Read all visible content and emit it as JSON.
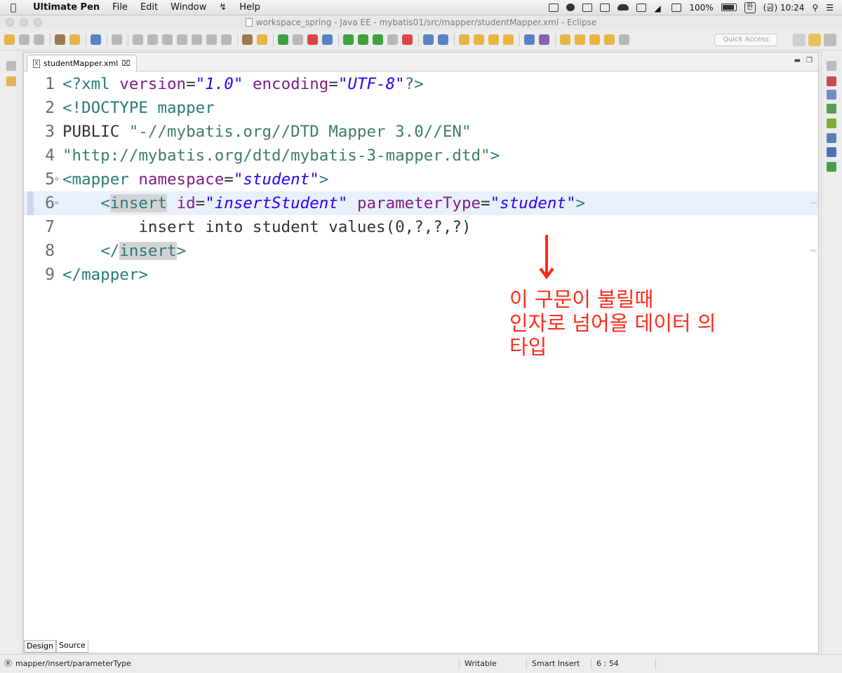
{
  "menubar": {
    "app_name": "Ultimate Pen",
    "items": [
      "File",
      "Edit",
      "Window",
      "Help"
    ],
    "battery": "100%",
    "input_source": "한",
    "clock": "(금) 10:24"
  },
  "window": {
    "title": "workspace_spring - Java EE - mybatis01/src/mapper/studentMapper.xml - Eclipse"
  },
  "toolbar": {
    "quick_access_placeholder": "Quick Access"
  },
  "editor": {
    "tab_label": "studentMapper.xml",
    "tab_icon": "X",
    "lines": [
      {
        "num": "1",
        "tokens": [
          {
            "c": "t",
            "s": "<?xml "
          },
          {
            "c": "a",
            "s": "version"
          },
          {
            "c": "pl",
            "s": "="
          },
          {
            "c": "v",
            "s": "\"1.0\""
          },
          {
            "c": "pl",
            "s": " "
          },
          {
            "c": "a",
            "s": "encoding"
          },
          {
            "c": "pl",
            "s": "="
          },
          {
            "c": "v",
            "s": "\"UTF-8\""
          },
          {
            "c": "t",
            "s": "?>"
          }
        ]
      },
      {
        "num": "2",
        "tokens": [
          {
            "c": "t",
            "s": "<!DOCTYPE mapper"
          }
        ]
      },
      {
        "num": "3",
        "tokens": [
          {
            "c": "pl",
            "s": "PUBLIC "
          },
          {
            "c": "d",
            "s": "\"-//mybatis.org//DTD Mapper 3.0//EN\""
          }
        ]
      },
      {
        "num": "4",
        "tokens": [
          {
            "c": "d",
            "s": "\"http://mybatis.org/dtd/mybatis-3-mapper.dtd\""
          },
          {
            "c": "t",
            "s": ">"
          }
        ]
      },
      {
        "num": "5",
        "fold": true,
        "tokens": [
          {
            "c": "t",
            "s": "<mapper "
          },
          {
            "c": "a",
            "s": "namespace"
          },
          {
            "c": "pl",
            "s": "="
          },
          {
            "c": "v",
            "s": "\"student\""
          },
          {
            "c": "t",
            "s": ">"
          }
        ]
      },
      {
        "num": "6",
        "fold": true,
        "current": true,
        "tokens": [
          {
            "c": "pl",
            "s": "    "
          },
          {
            "c": "t",
            "s": "<"
          },
          {
            "c": "t hl",
            "s": "insert"
          },
          {
            "c": "pl",
            "s": " "
          },
          {
            "c": "a",
            "s": "id"
          },
          {
            "c": "pl",
            "s": "="
          },
          {
            "c": "v",
            "s": "\"insertStudent\""
          },
          {
            "c": "pl",
            "s": " "
          },
          {
            "c": "a",
            "s": "parameterType"
          },
          {
            "c": "pl",
            "s": "="
          },
          {
            "c": "v",
            "s": "\"student\""
          },
          {
            "c": "t",
            "s": ">"
          }
        ]
      },
      {
        "num": "7",
        "tokens": [
          {
            "c": "pl",
            "s": "        insert into student values(0,?,?,?)"
          }
        ]
      },
      {
        "num": "8",
        "tokens": [
          {
            "c": "pl",
            "s": "    "
          },
          {
            "c": "t",
            "s": "</"
          },
          {
            "c": "t hl",
            "s": "insert"
          },
          {
            "c": "t",
            "s": ">"
          }
        ]
      },
      {
        "num": "9",
        "tokens": [
          {
            "c": "t",
            "s": "</mapper>"
          }
        ]
      }
    ],
    "annotation": [
      "이 구문이 불릴때",
      "인자로 넘어올 데이터 의",
      "타입"
    ],
    "annotation_color": "#ff2a1a",
    "bottom_tabs": [
      "Design",
      "Source"
    ]
  },
  "statusbar": {
    "path": "mapper/insert/parameterType",
    "writable": "Writable",
    "insert_mode": "Smart Insert",
    "position": "6 : 54"
  }
}
